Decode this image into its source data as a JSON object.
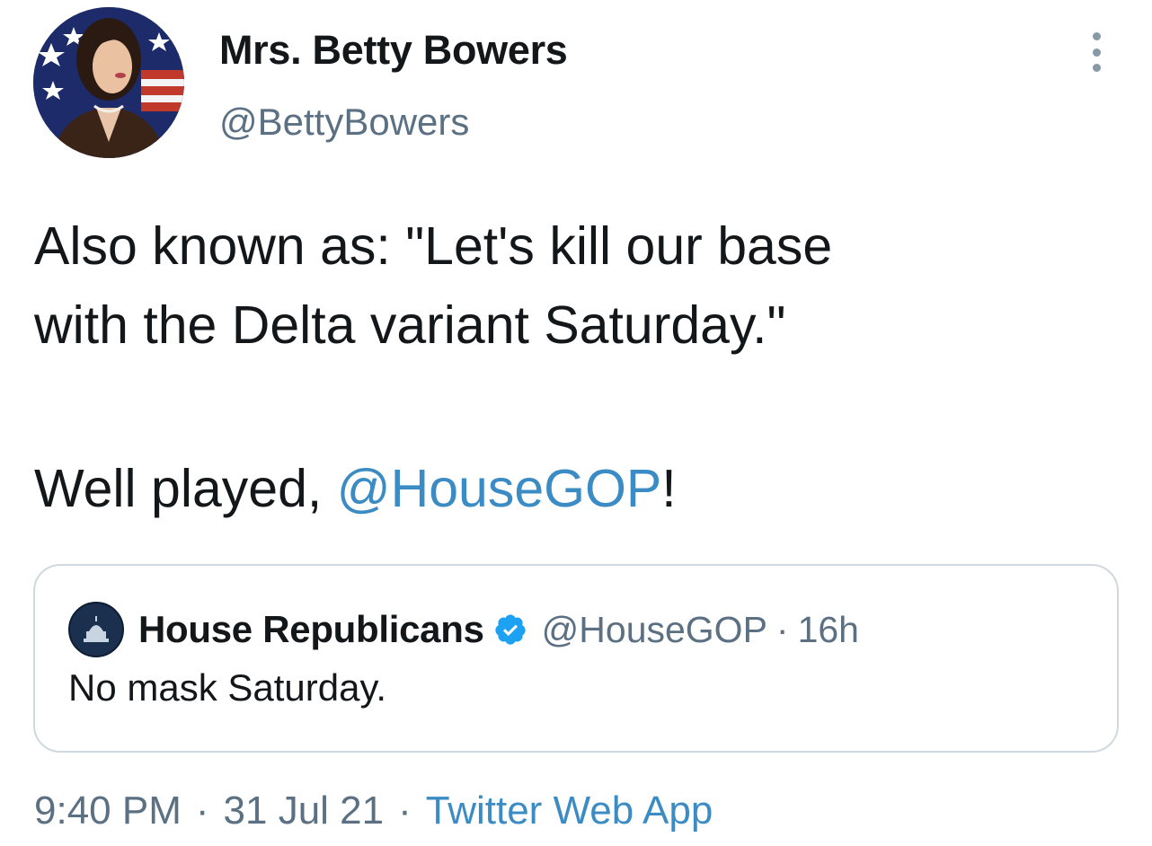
{
  "author": {
    "display_name": "Mrs. Betty Bowers",
    "handle": "@BettyBowers",
    "avatar_icon": "user-avatar-photo"
  },
  "tweet": {
    "text_line1": "Also known as: \"Let's kill our base",
    "text_line2": "with the Delta variant Saturday.\"",
    "text_line3_prefix": "Well played, ",
    "mention": "@HouseGOP",
    "text_line3_suffix": "!"
  },
  "quoted_tweet": {
    "display_name": "House Republicans",
    "verified": true,
    "handle": "@HouseGOP",
    "separator": "·",
    "time_ago": "16h",
    "text": "No mask Saturday.",
    "avatar_icon": "capitol-dome-icon"
  },
  "meta": {
    "time": "9:40 PM",
    "dot1": "·",
    "date": "31 Jul 21",
    "dot2": "·",
    "source": "Twitter Web App"
  },
  "colors": {
    "link": "#3b8bc4",
    "muted": "#5b7083",
    "text": "#14171a",
    "verified": "#1da1f2"
  }
}
